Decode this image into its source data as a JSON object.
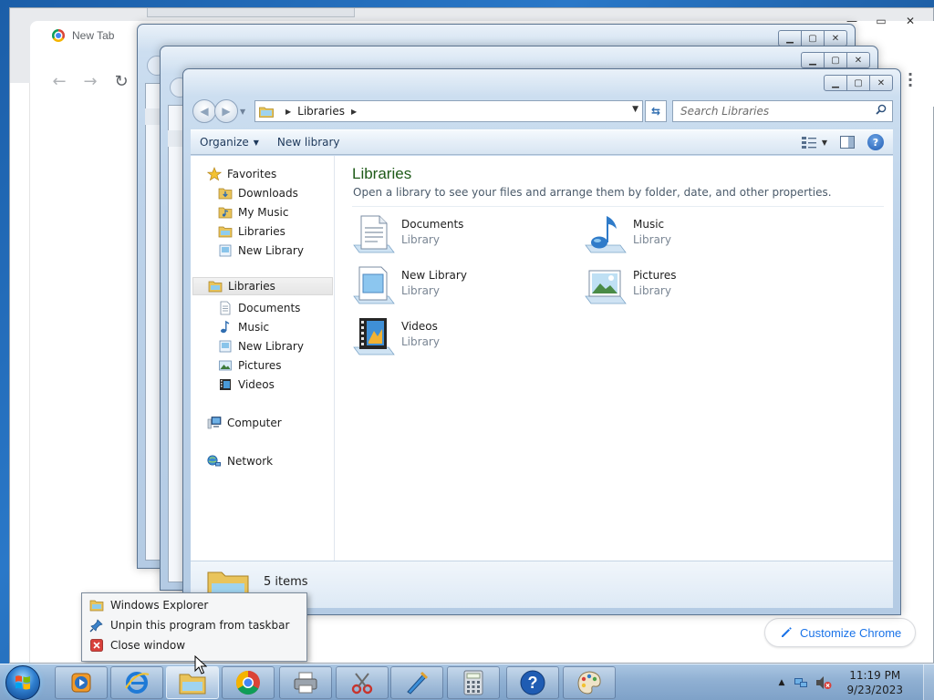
{
  "chrome": {
    "tab_title": "New Tab",
    "customize_label": "Customize Chrome"
  },
  "explorer": {
    "breadcrumb": [
      "Libraries"
    ],
    "search_placeholder": "Search Libraries",
    "toolbar": {
      "organize": "Organize",
      "new_library": "New library"
    },
    "nav": {
      "favorites": {
        "label": "Favorites",
        "items": [
          "Downloads",
          "My Music",
          "Libraries",
          "New Library"
        ]
      },
      "libraries": {
        "label": "Libraries",
        "items": [
          "Documents",
          "Music",
          "New Library",
          "Pictures",
          "Videos"
        ]
      },
      "computer": "Computer",
      "network": "Network"
    },
    "content": {
      "title": "Libraries",
      "subtitle": "Open a library to see your files and arrange them by folder, date, and other properties.",
      "items": [
        {
          "name": "Documents",
          "kind": "Library",
          "icon": "documents-library-icon"
        },
        {
          "name": "Music",
          "kind": "Library",
          "icon": "music-library-icon"
        },
        {
          "name": "New Library",
          "kind": "Library",
          "icon": "new-library-icon"
        },
        {
          "name": "Pictures",
          "kind": "Library",
          "icon": "pictures-library-icon"
        },
        {
          "name": "Videos",
          "kind": "Library",
          "icon": "videos-library-icon"
        }
      ]
    },
    "details": {
      "count": "5 items"
    }
  },
  "jumplist": {
    "items": [
      {
        "label": "Windows Explorer",
        "icon": "explorer-folder-icon"
      },
      {
        "label": "Unpin this program from taskbar",
        "icon": "unpin-icon"
      },
      {
        "label": "Close window",
        "icon": "close-window-icon"
      }
    ]
  },
  "taskbar": {
    "apps": [
      "media-player",
      "internet-explorer",
      "windows-explorer",
      "chrome",
      "printer",
      "snipping-tool",
      "paint-brush",
      "calculator",
      "help",
      "paint"
    ],
    "clock": {
      "time": "11:19 PM",
      "date": "9/23/2023"
    }
  },
  "colors": {
    "library_title": "#1e5a18",
    "chrome_accent": "#1a73e8",
    "taskbar": "#96b5d6"
  }
}
